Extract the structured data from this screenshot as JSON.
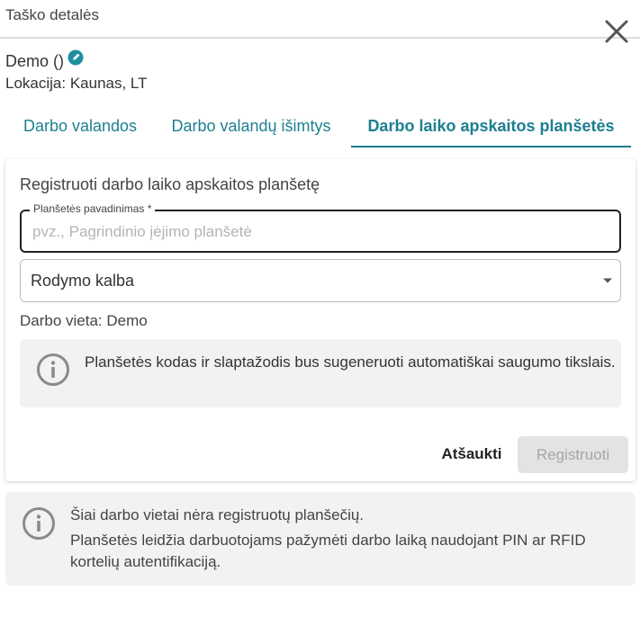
{
  "header": {
    "title": "Taško detalės",
    "close_icon": "close-icon"
  },
  "place": {
    "name": "Demo ()",
    "edit_icon": "edit-icon",
    "location": "Lokacija: Kaunas, LT"
  },
  "tabs": [
    {
      "label": "Darbo valandos",
      "active": false
    },
    {
      "label": "Darbo valandų išimtys",
      "active": false
    },
    {
      "label": "Darbo laiko apskaitos planšetės",
      "active": true
    }
  ],
  "form": {
    "title": "Registruoti darbo laiko apskaitos planšetę",
    "name_field": {
      "label": "Planšetės pavadinimas *",
      "placeholder": "pvz., Pagrindinio įėjimo planšetė",
      "value": ""
    },
    "language_select": {
      "value": "Rodymo kalba"
    },
    "workplace": "Darbo vieta: Demo",
    "info_text": "Planšetės kodas ir slaptažodis bus sugeneruoti automatiškai saugumo tikslais.",
    "cancel_label": "Atšaukti",
    "submit_label": "Registruoti",
    "submit_disabled": true
  },
  "empty_state": {
    "line1": "Šiai darbo vietai nėra registruotų planšečių.",
    "line2": "Planšetės leidžia darbuotojams pažymėti darbo laiką naudojant PIN ar RFID kortelių autentifikaciją."
  },
  "colors": {
    "accent": "#1d7f90",
    "info_bg": "#f2f2f2",
    "disabled_bg": "#e3e3e3"
  }
}
